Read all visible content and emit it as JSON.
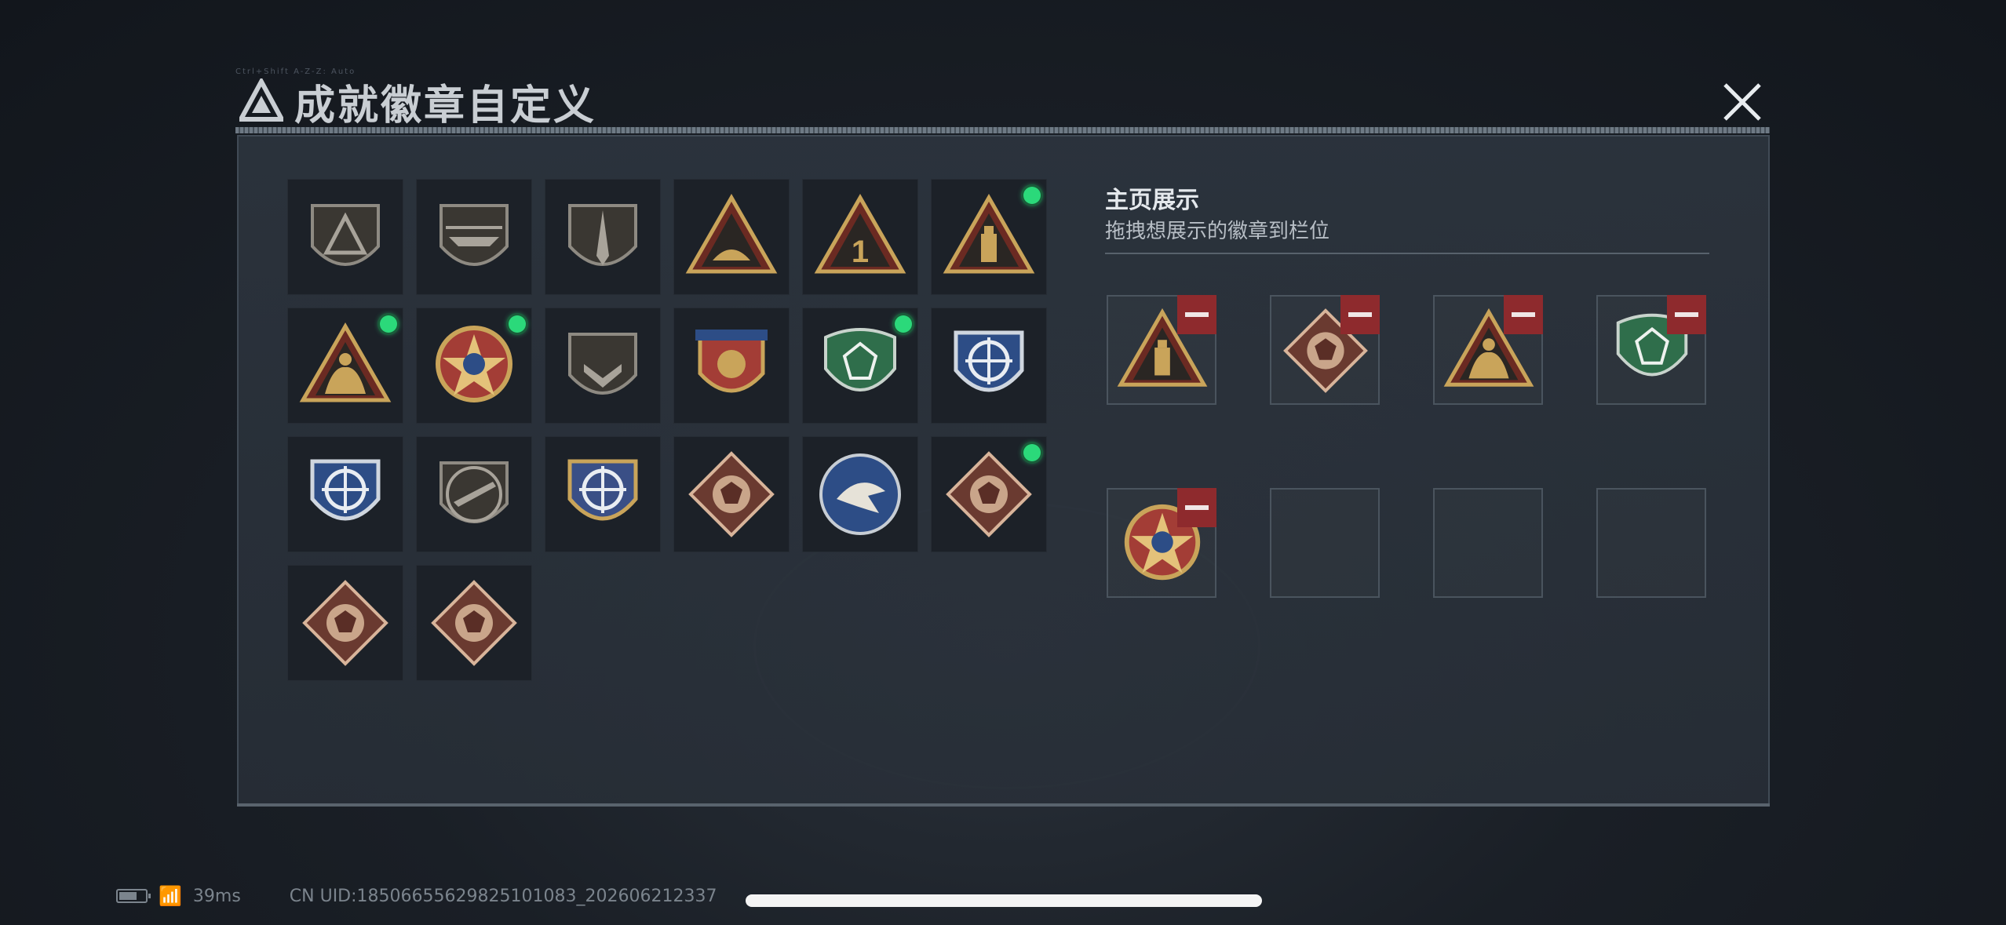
{
  "header": {
    "title": "成就徽章自定义",
    "deco_text": "Ctrl+Shift A-Z-Z: Auto"
  },
  "badge_grid": {
    "badges": [
      {
        "name": "gray-shield-logo-badge-icon",
        "new": false
      },
      {
        "name": "helicopter-shield-badge-icon",
        "new": false
      },
      {
        "name": "dagger-shield-badge-icon",
        "new": false
      },
      {
        "name": "gold-triangle-boat-badge-icon",
        "new": false
      },
      {
        "name": "number-one-triangle-badge-icon",
        "new": false
      },
      {
        "name": "usb-triangle-badge-icon",
        "new": true
      },
      {
        "name": "soldiers-triangle-badge-icon",
        "new": true
      },
      {
        "name": "star-medallion-badge-icon",
        "new": true
      },
      {
        "name": "chevron-shield-badge-icon",
        "new": false
      },
      {
        "name": "winged-crest-badge-icon",
        "new": false
      },
      {
        "name": "green-gem-shield-badge-icon",
        "new": true
      },
      {
        "name": "blue-rifle-crosshair-badge-icon",
        "new": false
      },
      {
        "name": "blue-sniper-crosshair-badge-icon",
        "new": false
      },
      {
        "name": "rifle-shield-badge-icon",
        "new": false
      },
      {
        "name": "gold-crosshair-badge-icon",
        "new": false
      },
      {
        "name": "wolf-diamond-badge-icon",
        "new": false
      },
      {
        "name": "eagle-round-badge-icon",
        "new": false
      },
      {
        "name": "dragon-diamond-badge-icon",
        "new": true
      },
      {
        "name": "dragon-diamond-red-badge-icon",
        "new": false
      },
      {
        "name": "runner-diamond-badge-icon",
        "new": false
      }
    ]
  },
  "showcase": {
    "title": "主页展示",
    "subtitle": "拖拽想展示的徽章到栏位",
    "slots": [
      {
        "badge": "usb-triangle-badge-icon"
      },
      {
        "badge": "dragon-diamond-badge-icon"
      },
      {
        "badge": "soldiers-triangle-badge-icon"
      },
      {
        "badge": "green-gem-shield-badge-icon"
      },
      {
        "badge": "star-medallion-badge-icon"
      },
      {
        "badge": ""
      },
      {
        "badge": ""
      },
      {
        "badge": ""
      }
    ]
  },
  "status_bar": {
    "ping": "39ms",
    "uid": "CN UID:1850665562982510108​3_202606212337"
  },
  "colors": {
    "accent_green": "#2bd97a",
    "remove_red": "#8e2a2d",
    "gold": "#c9a45a"
  }
}
